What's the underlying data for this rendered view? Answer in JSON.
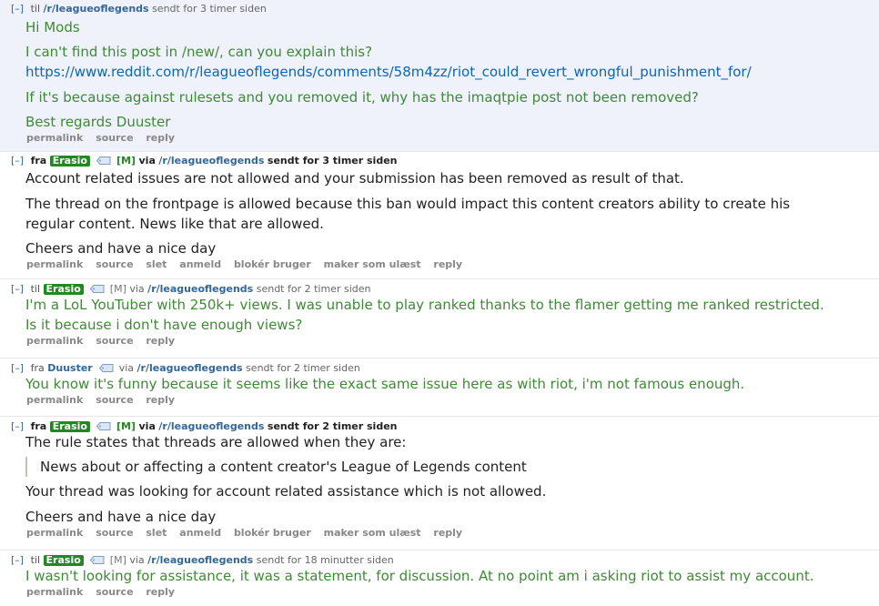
{
  "messages": [
    {
      "expand": "[–]",
      "prep": "til",
      "subreddit": "/r/leagueoflegends",
      "time": "sendt for 3 timer siden",
      "paragraphs": {
        "p1": "Hi Mods",
        "p2": "I can't find this post in /new/, can you explain this?",
        "link": "https://www.reddit.com/r/leagueoflegends/comments/58m4zz/riot_could_revert_wrongful_punishment_for/",
        "p3": "If it's because against rulesets and you removed it, why has the imaqtpie post not been removed?",
        "p4": "Best regards Duuster"
      },
      "buttons": [
        "permalink",
        "source",
        "reply"
      ]
    },
    {
      "expand": "[–]",
      "prep": "fra",
      "author": "Erasio",
      "mod": "[M]",
      "via": "via",
      "subreddit": "/r/leagueoflegends",
      "time": "sendt for 3 timer siden",
      "paragraphs": {
        "p1": "Account related issues are not allowed and your submission has been removed as result of that.",
        "p2a": "The thread on the frontpage is allowed because this ban would impact this content creators ability to create his",
        "p2b": "regular content. News like that are allowed.",
        "p3": "Cheers and have a nice day"
      },
      "buttons": [
        "permalink",
        "source",
        "slet",
        "anmeld",
        "blokér bruger",
        "maker som ulæst",
        "reply"
      ]
    },
    {
      "expand": "[–]",
      "prep": "til",
      "author": "Erasio",
      "mod": "[M]",
      "via": "via",
      "subreddit": "/r/leagueoflegends",
      "time": "sendt for 2 timer siden",
      "paragraphs": {
        "p1a": "I'm a LoL YouTuber with 250k+ views. I was unable to play ranked thanks to the flamer getting me ranked restricted.",
        "p1b": "Is it because i don't have enough views?"
      },
      "buttons": [
        "permalink",
        "source",
        "reply"
      ]
    },
    {
      "expand": "[–]",
      "prep": "fra",
      "author": "Duuster",
      "via": "via",
      "subreddit": "/r/leagueoflegends",
      "time": "sendt for 2 timer siden",
      "paragraphs": {
        "p1": "You know it's funny because it seems like the exact same issue here as with riot, i'm not famous enough."
      },
      "buttons": [
        "permalink",
        "source",
        "reply"
      ]
    },
    {
      "expand": "[–]",
      "prep": "fra",
      "author": "Erasio",
      "mod": "[M]",
      "via": "via",
      "subreddit": "/r/leagueoflegends",
      "time": "sendt for 2 timer siden",
      "paragraphs": {
        "p1": "The rule states that threads are allowed when they are:",
        "quote": "News about or affecting a content creator's League of Legends content",
        "p2": "Your thread was looking for account related assistance which is not allowed.",
        "p3": "Cheers and have a nice day"
      },
      "buttons": [
        "permalink",
        "source",
        "slet",
        "anmeld",
        "blokér bruger",
        "maker som ulæst",
        "reply"
      ]
    },
    {
      "expand": "[–]",
      "prep": "til",
      "author": "Erasio",
      "mod": "[M]",
      "via": "via",
      "subreddit": "/r/leagueoflegends",
      "time": "sendt for 18 minutter siden",
      "paragraphs": {
        "p1": "I wasn't looking for assistance, it was a statement, for discussion. At no point am i asking riot to assist my account."
      },
      "buttons": [
        "permalink",
        "source",
        "reply"
      ]
    }
  ]
}
